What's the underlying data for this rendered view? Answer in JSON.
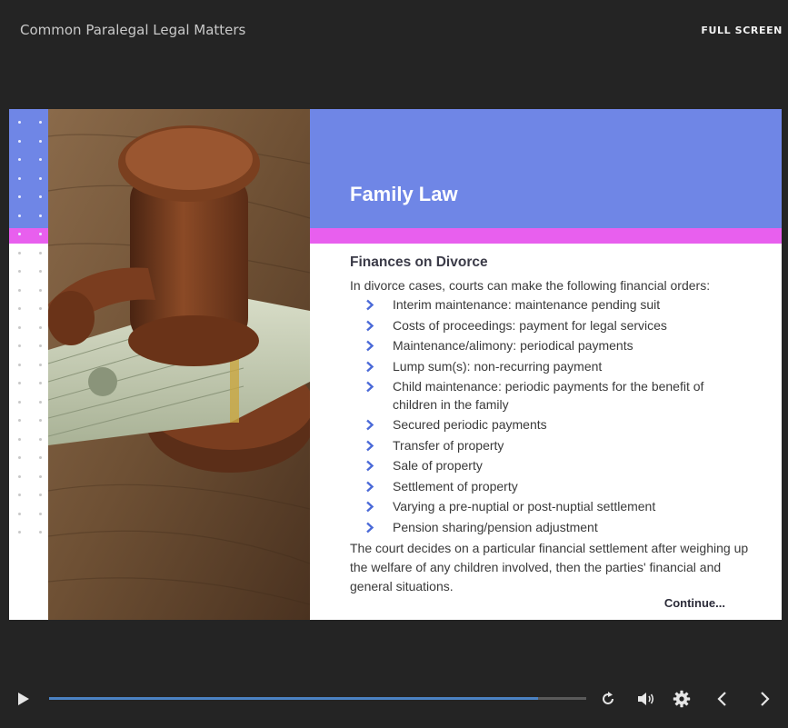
{
  "header": {
    "course_title": "Common Paralegal Legal Matters",
    "fullscreen_label": "FULL SCREEN"
  },
  "slide": {
    "title": "Family Law",
    "subheading": "Finances on Divorce",
    "intro": "In divorce cases, courts can make the following financial orders:",
    "orders": [
      "Interim maintenance: maintenance pending suit",
      "Costs of proceedings: payment for legal services",
      "Maintenance/alimony: periodical payments",
      "Lump sum(s): non-recurring payment",
      "Child maintenance: periodic payments for the benefit of children in the family",
      "Secured periodic payments",
      "Transfer of property",
      "Sale of property",
      "Settlement of property",
      "Varying a pre-nuptial or post-nuptial settlement",
      "Pension sharing/pension adjustment"
    ],
    "closing": "The court decides on a particular financial settlement after weighing up the welfare of any children involved, then the parties' financial and general situations.",
    "continue_label": "Continue..."
  },
  "player": {
    "progress_fraction": 0.91,
    "icons": [
      "play-icon",
      "replay-icon",
      "volume-icon",
      "settings-icon",
      "prev-icon",
      "next-icon"
    ]
  },
  "colors": {
    "background": "#242424",
    "header_blue": "#6f86e6",
    "accent_pink": "#e85fee",
    "chevron_blue": "#4b6ad8",
    "progress_blue": "#4b82c3"
  }
}
